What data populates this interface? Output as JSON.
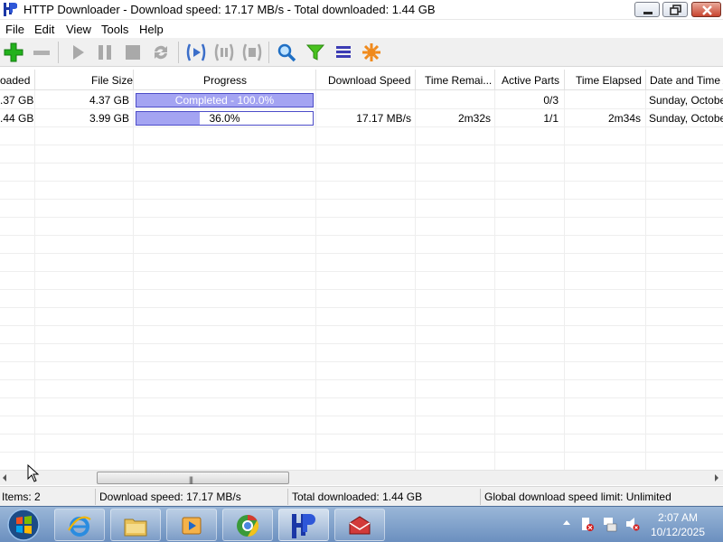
{
  "window": {
    "title": "HTTP Downloader - Download speed: 17.17 MB/s - Total downloaded: 1.44 GB"
  },
  "menu": [
    "File",
    "Edit",
    "View",
    "Tools",
    "Help"
  ],
  "toolbar": {
    "icons": [
      "add-icon",
      "remove-icon",
      "start-icon",
      "pause-icon",
      "stop-icon",
      "restart-icon",
      "start-all-icon",
      "pause-all-icon",
      "stop-all-icon",
      "search-icon",
      "filter-icon",
      "queue-icon",
      "options-icon"
    ]
  },
  "columns": [
    "oaded",
    "File Size",
    "Progress",
    "Download Speed",
    "Time Remai...",
    "Active Parts",
    "Time Elapsed",
    "Date and Time A"
  ],
  "downloads": [
    {
      "downloaded": ".37 GB",
      "file_size": "4.37 GB",
      "progress_text": "Completed - 100.0%",
      "progress": 1.0,
      "download_speed": "",
      "time_remaining": "",
      "active_parts": "0/3",
      "time_elapsed": "",
      "date_time": "Sunday, October"
    },
    {
      "downloaded": ".44 GB",
      "file_size": "3.99 GB",
      "progress_text": "36.0%",
      "progress": 0.36,
      "download_speed": "17.17 MB/s",
      "time_remaining": "2m32s",
      "active_parts": "1/1",
      "time_elapsed": "2m34s",
      "date_time": "Sunday, October"
    }
  ],
  "status": {
    "items": "Items: 2",
    "download_speed": "Download speed: 17.17 MB/s",
    "total_downloaded": "Total downloaded: 1.44 GB",
    "speed_limit": "Global download speed limit: Unlimited"
  },
  "taskbar": {
    "apps": [
      "internet-explorer-icon",
      "file-explorer-icon",
      "media-player-icon",
      "chrome-icon",
      "http-downloader-icon",
      "toolbox-icon"
    ],
    "time": "2:07 AM",
    "date": "10/12/2025"
  },
  "colors": {
    "progress_border": "#4c4cc8",
    "progress_fill": "#a4a4f2",
    "taskbar": "#7f9fcb"
  }
}
